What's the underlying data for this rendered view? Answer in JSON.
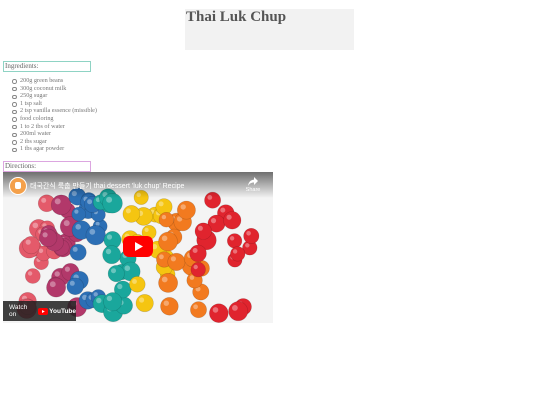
{
  "page": {
    "title": "Thai Luk Chup"
  },
  "ingredients": {
    "label": "Ingredients:",
    "items": [
      "200g green beans",
      "300g coconut milk",
      "250g sugar",
      "1 tsp salt",
      "2 tsp vanilla essence (missible)",
      "food coloring",
      "1 to 2 tbs of water",
      "200ml water",
      "2 tbs sugar",
      "1 tbs agar powder"
    ]
  },
  "directions": {
    "label": "Directions:"
  },
  "video": {
    "title": "태국간식 룩춥 만들기 thai dessert 'luk chup' Recipe",
    "share_label": "Share",
    "watch_label": "Watch on",
    "platform": "YouTube",
    "colors": {
      "play": "#ff0000",
      "candy_red": "#e0242e",
      "candy_orange": "#f27a1f",
      "candy_yellow": "#f5c511",
      "candy_teal": "#1aa79c",
      "candy_blue": "#2c6fb5",
      "candy_pink": "#e45a6a",
      "candy_magenta": "#b2386a"
    }
  }
}
